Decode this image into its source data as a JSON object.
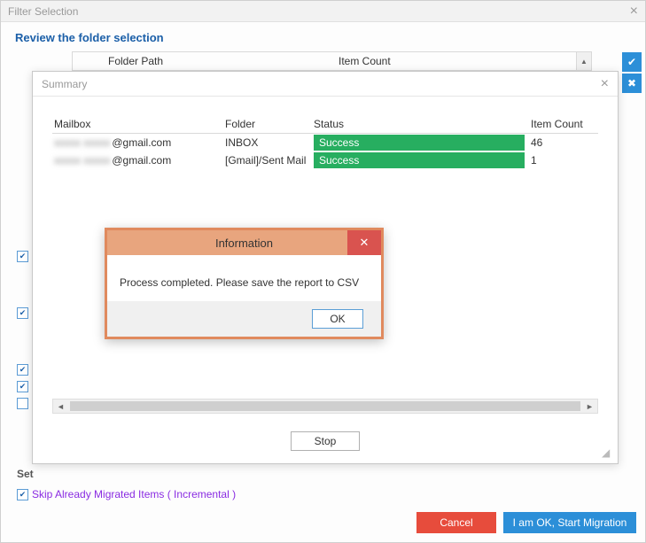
{
  "filterWindow": {
    "title": "Filter Selection",
    "reviewLabel": "Review the folder selection",
    "columns": {
      "folderPath": "Folder Path",
      "itemCount": "Item Count"
    },
    "setLabel": "Set",
    "skipLabel": "Skip Already Migrated Items ( Incremental )",
    "buttons": {
      "cancel": "Cancel",
      "start": "I am OK, Start Migration"
    },
    "sideIcons": {
      "checkAll": "✔",
      "uncheckAll": "✖"
    }
  },
  "summary": {
    "title": "Summary",
    "headers": {
      "mailbox": "Mailbox",
      "folder": "Folder",
      "status": "Status",
      "itemCount": "Item Count"
    },
    "rows": [
      {
        "mailboxHidden": "xxxxx xxxxx",
        "mailboxVisible": "@gmail.com",
        "folder": "INBOX",
        "status": "Success",
        "itemCount": "46"
      },
      {
        "mailboxHidden": "xxxxx xxxxx",
        "mailboxVisible": "@gmail.com",
        "folder": "[Gmail]/Sent Mail",
        "status": "Success",
        "itemCount": "1"
      }
    ],
    "stop": "Stop",
    "scroll": {
      "left": "◄",
      "right": "►"
    }
  },
  "info": {
    "title": "Information",
    "closeGlyph": "✕",
    "message": "Process completed. Please save the report to CSV",
    "ok": "OK"
  }
}
